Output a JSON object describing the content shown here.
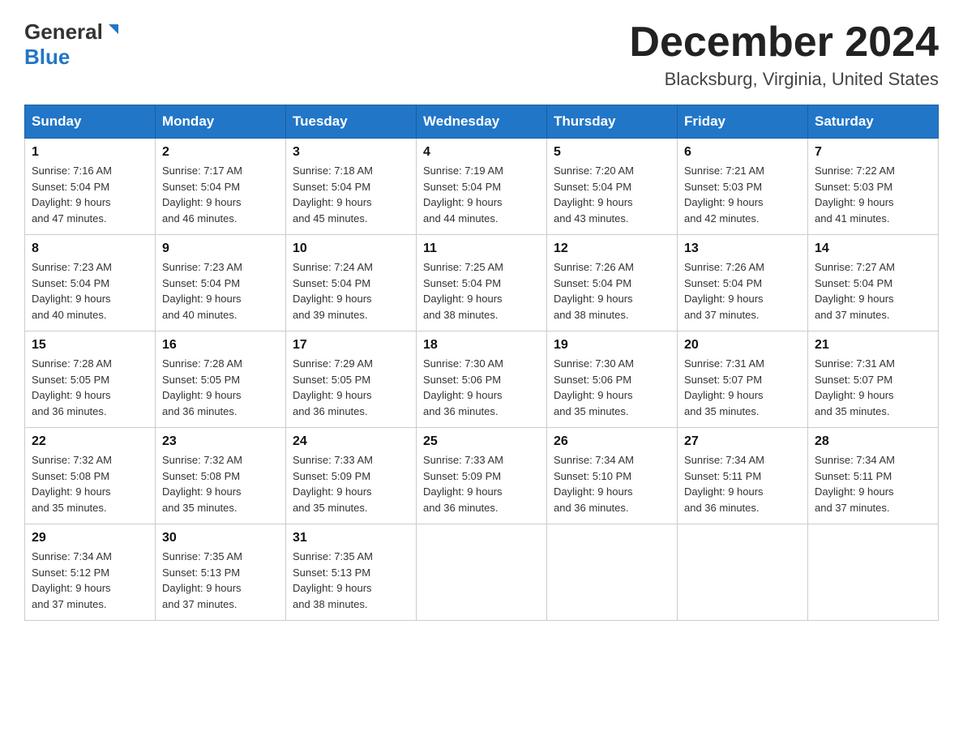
{
  "header": {
    "logo_general": "General",
    "logo_blue": "Blue",
    "month_title": "December 2024",
    "location": "Blacksburg, Virginia, United States"
  },
  "weekdays": [
    "Sunday",
    "Monday",
    "Tuesday",
    "Wednesday",
    "Thursday",
    "Friday",
    "Saturday"
  ],
  "weeks": [
    [
      {
        "day": "1",
        "sunrise": "7:16 AM",
        "sunset": "5:04 PM",
        "daylight": "9 hours and 47 minutes."
      },
      {
        "day": "2",
        "sunrise": "7:17 AM",
        "sunset": "5:04 PM",
        "daylight": "9 hours and 46 minutes."
      },
      {
        "day": "3",
        "sunrise": "7:18 AM",
        "sunset": "5:04 PM",
        "daylight": "9 hours and 45 minutes."
      },
      {
        "day": "4",
        "sunrise": "7:19 AM",
        "sunset": "5:04 PM",
        "daylight": "9 hours and 44 minutes."
      },
      {
        "day": "5",
        "sunrise": "7:20 AM",
        "sunset": "5:04 PM",
        "daylight": "9 hours and 43 minutes."
      },
      {
        "day": "6",
        "sunrise": "7:21 AM",
        "sunset": "5:03 PM",
        "daylight": "9 hours and 42 minutes."
      },
      {
        "day": "7",
        "sunrise": "7:22 AM",
        "sunset": "5:03 PM",
        "daylight": "9 hours and 41 minutes."
      }
    ],
    [
      {
        "day": "8",
        "sunrise": "7:23 AM",
        "sunset": "5:04 PM",
        "daylight": "9 hours and 40 minutes."
      },
      {
        "day": "9",
        "sunrise": "7:23 AM",
        "sunset": "5:04 PM",
        "daylight": "9 hours and 40 minutes."
      },
      {
        "day": "10",
        "sunrise": "7:24 AM",
        "sunset": "5:04 PM",
        "daylight": "9 hours and 39 minutes."
      },
      {
        "day": "11",
        "sunrise": "7:25 AM",
        "sunset": "5:04 PM",
        "daylight": "9 hours and 38 minutes."
      },
      {
        "day": "12",
        "sunrise": "7:26 AM",
        "sunset": "5:04 PM",
        "daylight": "9 hours and 38 minutes."
      },
      {
        "day": "13",
        "sunrise": "7:26 AM",
        "sunset": "5:04 PM",
        "daylight": "9 hours and 37 minutes."
      },
      {
        "day": "14",
        "sunrise": "7:27 AM",
        "sunset": "5:04 PM",
        "daylight": "9 hours and 37 minutes."
      }
    ],
    [
      {
        "day": "15",
        "sunrise": "7:28 AM",
        "sunset": "5:05 PM",
        "daylight": "9 hours and 36 minutes."
      },
      {
        "day": "16",
        "sunrise": "7:28 AM",
        "sunset": "5:05 PM",
        "daylight": "9 hours and 36 minutes."
      },
      {
        "day": "17",
        "sunrise": "7:29 AM",
        "sunset": "5:05 PM",
        "daylight": "9 hours and 36 minutes."
      },
      {
        "day": "18",
        "sunrise": "7:30 AM",
        "sunset": "5:06 PM",
        "daylight": "9 hours and 36 minutes."
      },
      {
        "day": "19",
        "sunrise": "7:30 AM",
        "sunset": "5:06 PM",
        "daylight": "9 hours and 35 minutes."
      },
      {
        "day": "20",
        "sunrise": "7:31 AM",
        "sunset": "5:07 PM",
        "daylight": "9 hours and 35 minutes."
      },
      {
        "day": "21",
        "sunrise": "7:31 AM",
        "sunset": "5:07 PM",
        "daylight": "9 hours and 35 minutes."
      }
    ],
    [
      {
        "day": "22",
        "sunrise": "7:32 AM",
        "sunset": "5:08 PM",
        "daylight": "9 hours and 35 minutes."
      },
      {
        "day": "23",
        "sunrise": "7:32 AM",
        "sunset": "5:08 PM",
        "daylight": "9 hours and 35 minutes."
      },
      {
        "day": "24",
        "sunrise": "7:33 AM",
        "sunset": "5:09 PM",
        "daylight": "9 hours and 35 minutes."
      },
      {
        "day": "25",
        "sunrise": "7:33 AM",
        "sunset": "5:09 PM",
        "daylight": "9 hours and 36 minutes."
      },
      {
        "day": "26",
        "sunrise": "7:34 AM",
        "sunset": "5:10 PM",
        "daylight": "9 hours and 36 minutes."
      },
      {
        "day": "27",
        "sunrise": "7:34 AM",
        "sunset": "5:11 PM",
        "daylight": "9 hours and 36 minutes."
      },
      {
        "day": "28",
        "sunrise": "7:34 AM",
        "sunset": "5:11 PM",
        "daylight": "9 hours and 37 minutes."
      }
    ],
    [
      {
        "day": "29",
        "sunrise": "7:34 AM",
        "sunset": "5:12 PM",
        "daylight": "9 hours and 37 minutes."
      },
      {
        "day": "30",
        "sunrise": "7:35 AM",
        "sunset": "5:13 PM",
        "daylight": "9 hours and 37 minutes."
      },
      {
        "day": "31",
        "sunrise": "7:35 AM",
        "sunset": "5:13 PM",
        "daylight": "9 hours and 38 minutes."
      },
      null,
      null,
      null,
      null
    ]
  ],
  "labels": {
    "sunrise": "Sunrise:",
    "sunset": "Sunset:",
    "daylight": "Daylight:"
  }
}
